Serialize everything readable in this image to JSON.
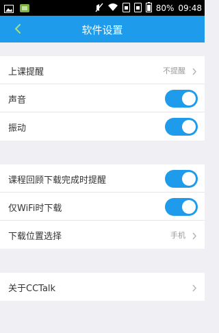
{
  "status_bar": {
    "battery": "80%",
    "time": "09:48",
    "left_icons": [
      "image-icon",
      "android-icon"
    ],
    "right_icons": [
      "mute-icon",
      "wifi-icon",
      "sim-icon",
      "sim2-icon",
      "battery-icon"
    ]
  },
  "header": {
    "title": "软件设置",
    "back_icon": "chevron-left-icon",
    "color": "#1e9bea"
  },
  "group1": {
    "items": [
      {
        "label": "上课提醒",
        "value": "不提醒"
      },
      {
        "label": "声音",
        "toggle": true
      },
      {
        "label": "振动",
        "toggle": true
      }
    ]
  },
  "group2": {
    "items": [
      {
        "label": "课程回顾下载完成时提醒",
        "toggle": true
      },
      {
        "label": "仅WiFi时下载",
        "toggle": true
      },
      {
        "label": "下载位置选择",
        "value": "手机"
      }
    ]
  },
  "group3": {
    "items": [
      {
        "label": "关于CCTalk"
      }
    ]
  },
  "colors": {
    "accent": "#1e9bea",
    "background": "#efeff4"
  }
}
